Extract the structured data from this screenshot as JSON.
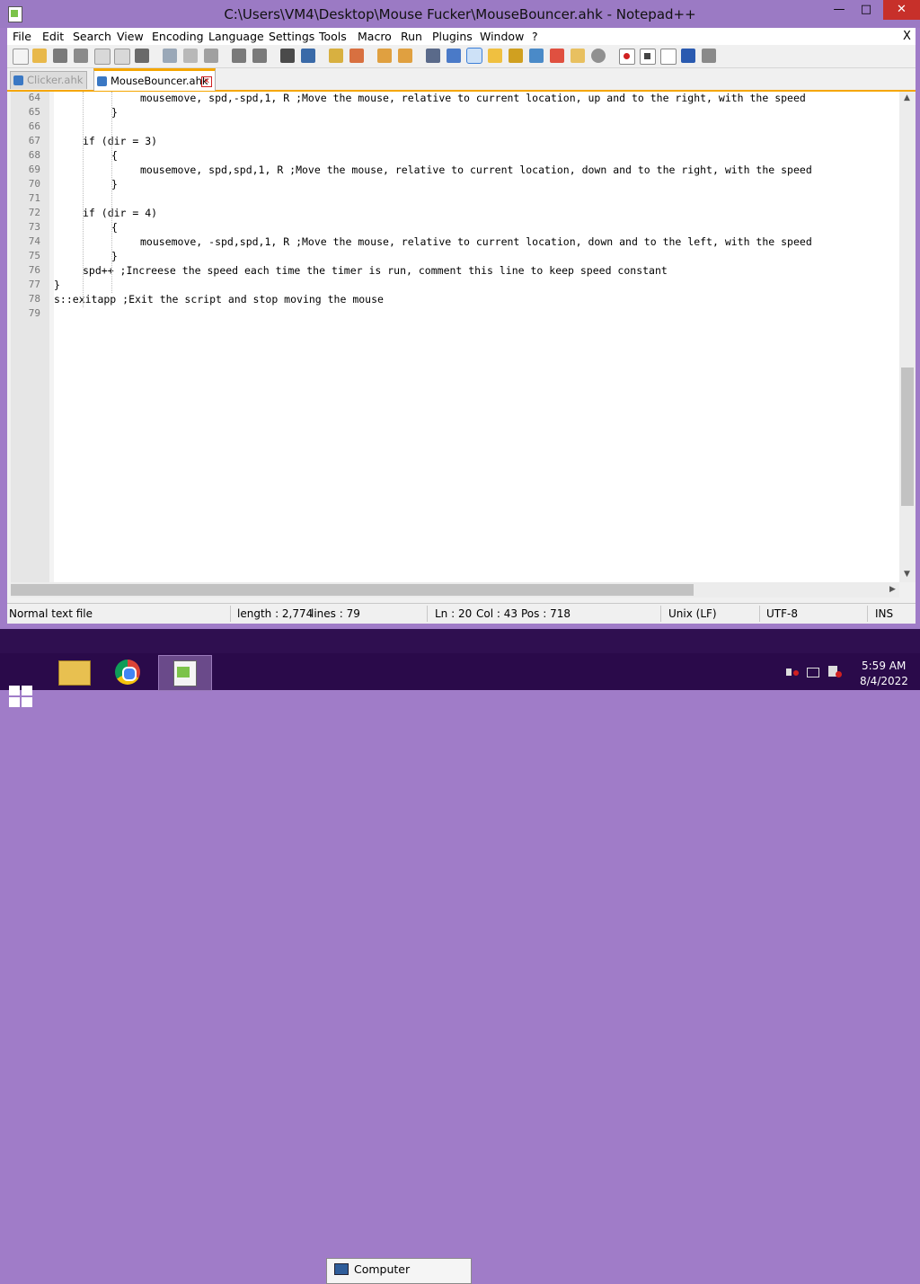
{
  "window": {
    "title": "C:\\Users\\VM4\\Desktop\\Mouse Fucker\\MouseBouncer.ahk - Notepad++",
    "buttons": {
      "minimize": "—",
      "maximize": "□",
      "close": "✕"
    }
  },
  "menu": {
    "items": [
      "File",
      "Edit",
      "Search",
      "View",
      "Encoding",
      "Language",
      "Settings",
      "Tools",
      "Macro",
      "Run",
      "Plugins",
      "Window",
      "?"
    ],
    "close_label": "X"
  },
  "toolbar": {
    "icons": [
      "new-file-icon",
      "open-file-icon",
      "save-icon",
      "save-all-icon",
      "close-icon",
      "close-all-icon",
      "print-icon",
      "cut-icon",
      "copy-icon",
      "paste-icon",
      "undo-icon",
      "redo-icon",
      "find-icon",
      "replace-icon",
      "zoom-in-icon",
      "zoom-out-icon",
      "sync-vertical-icon",
      "sync-horizontal-icon",
      "word-wrap-icon",
      "show-all-chars-icon",
      "indent-guide-icon",
      "user-defined-language-icon",
      "doc-map-icon",
      "function-list-icon",
      "folder-workspace-icon",
      "monitoring-icon",
      "eye-icon",
      "record-macro-icon",
      "stop-recording-icon",
      "play-macro-icon",
      "run-macro-multiple-icon",
      "save-macro-icon"
    ]
  },
  "tabs": [
    {
      "label": "Clicker.ahk",
      "active": false
    },
    {
      "label": "MouseBouncer.ahk",
      "active": true
    }
  ],
  "editor": {
    "lines": [
      {
        "num": "64",
        "indent": 3,
        "text": "mousemove, spd,-spd,1, R ;Move the mouse, relative to current location, up and to the right, with the speed"
      },
      {
        "num": "65",
        "indent": 2,
        "text": "}"
      },
      {
        "num": "66",
        "indent": 0,
        "text": ""
      },
      {
        "num": "67",
        "indent": 1,
        "text": "if (dir = 3)"
      },
      {
        "num": "68",
        "indent": 2,
        "text": "{"
      },
      {
        "num": "69",
        "indent": 3,
        "text": "mousemove, spd,spd,1, R ;Move the mouse, relative to current location, down and to the right, with the speed"
      },
      {
        "num": "70",
        "indent": 2,
        "text": "}"
      },
      {
        "num": "71",
        "indent": 0,
        "text": ""
      },
      {
        "num": "72",
        "indent": 1,
        "text": "if (dir = 4)"
      },
      {
        "num": "73",
        "indent": 2,
        "text": "{"
      },
      {
        "num": "74",
        "indent": 3,
        "text": "mousemove, -spd,spd,1, R ;Move the mouse, relative to current location, down and to the left, with the speed"
      },
      {
        "num": "75",
        "indent": 2,
        "text": "}"
      },
      {
        "num": "76",
        "indent": 1,
        "text": "spd++ ;Increese the speed each time the timer is run, comment this line to keep speed constant"
      },
      {
        "num": "77",
        "indent": 0,
        "text": "}"
      },
      {
        "num": "78",
        "indent": 0,
        "text": "s::exitapp ;Exit the script and stop moving the mouse"
      },
      {
        "num": "79",
        "indent": 0,
        "text": ""
      }
    ]
  },
  "statusbar": {
    "file_type": "Normal text file",
    "length": "length : 2,774",
    "lines": "lines : 79",
    "ln": "Ln : 20",
    "col": "Col : 43",
    "pos": "Pos : 718",
    "eol": "Unix (LF)",
    "encoding": "UTF-8",
    "mode": "INS"
  },
  "taskbar": {
    "preview_label": "Computer",
    "time": "5:59 AM",
    "date": "8/4/2022"
  }
}
